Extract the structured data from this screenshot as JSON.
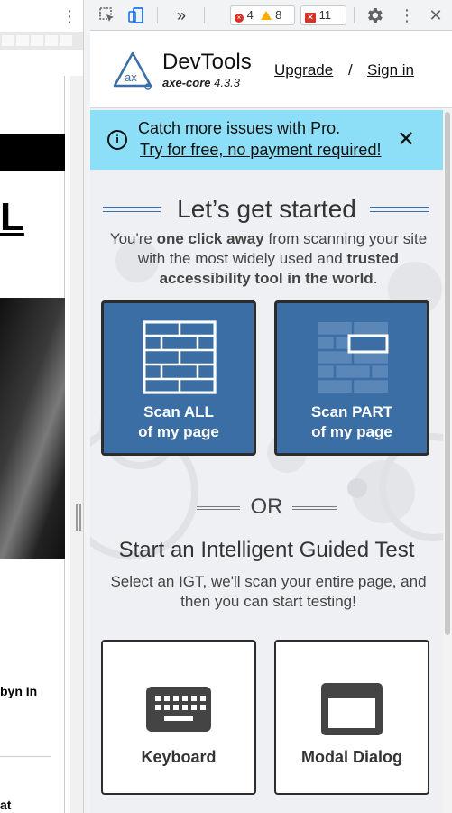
{
  "left_page": {
    "big_letter": "L",
    "caption": "byn In",
    "bottom_text": "at"
  },
  "toolbar": {
    "error_count": "4",
    "warning_count": "8",
    "issue_count": "11",
    "more_tabs": "»"
  },
  "axe": {
    "title": "DevTools",
    "core_name": "axe-core",
    "core_version": "4.3.3",
    "upgrade": "Upgrade",
    "separator": "/",
    "sign_in": "Sign in",
    "logo_text": "ax"
  },
  "promo": {
    "title": "Catch more issues with Pro.",
    "link": "Try for free, no payment required!",
    "close": "✕",
    "info": "i"
  },
  "start": {
    "heading": "Let’s get started",
    "intro_1": "You're ",
    "intro_bold_1": "one click away",
    "intro_2": " from scanning your site with the most widely used and ",
    "intro_bold_2": "trusted accessibility tool in the world",
    "intro_3": "."
  },
  "scan": {
    "all_line1": "Scan ALL",
    "all_line2": "of my page",
    "part_line1": "Scan PART",
    "part_line2": "of my page"
  },
  "or_text": "OR",
  "igt": {
    "title": "Start an Intelligent Guided Test",
    "description": "Select an IGT, we'll scan your entire page, and then you can start testing!",
    "cards": [
      {
        "label": "Keyboard",
        "icon": "keyboard-icon"
      },
      {
        "label": "Modal Dialog",
        "icon": "modal-dialog-icon"
      }
    ]
  },
  "colors": {
    "promo_bg": "#8cdff7",
    "scan_card_bg": "#3a6ea5",
    "panel_bg": "#eef0f3",
    "error_red": "#d93025",
    "warning_yellow": "#f9ab00",
    "rule_blue": "#3c6fa5"
  }
}
